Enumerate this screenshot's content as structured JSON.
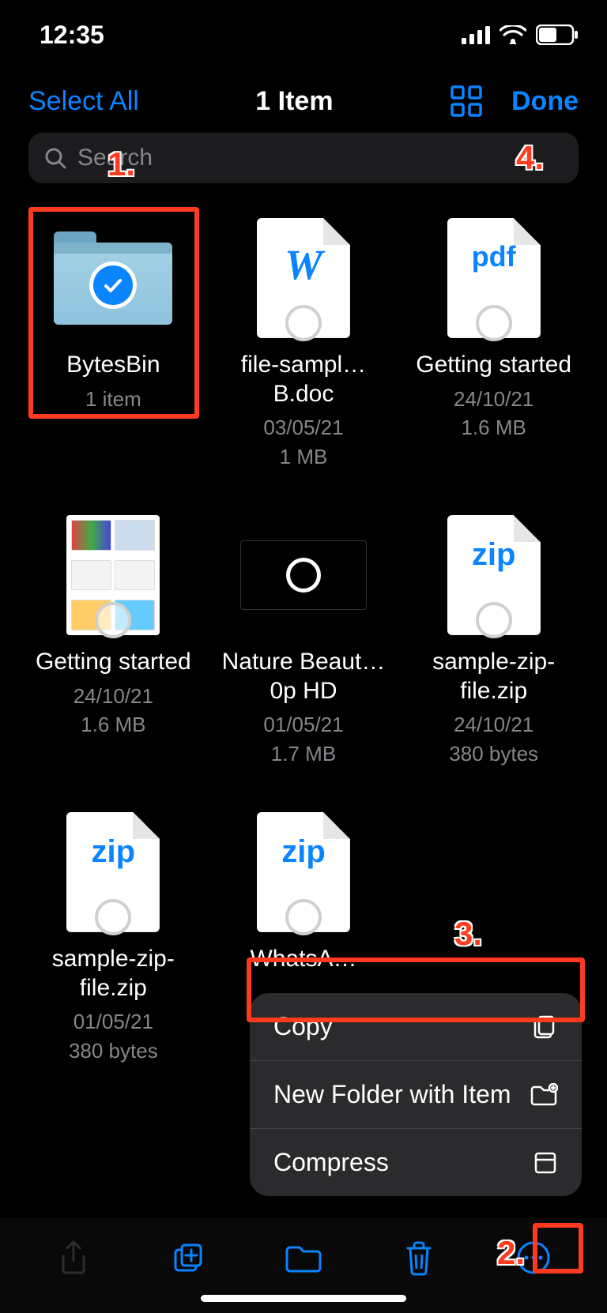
{
  "status": {
    "time": "12:35"
  },
  "nav": {
    "select_all": "Select All",
    "title": "1 Item",
    "done": "Done"
  },
  "search": {
    "placeholder": "Search"
  },
  "files": [
    {
      "name": "BytesBin",
      "meta1": "1 item",
      "meta2": ""
    },
    {
      "name": "file-sampl…B.doc",
      "meta1": "03/05/21",
      "meta2": "1 MB"
    },
    {
      "name": "Getting started",
      "meta1": "24/10/21",
      "meta2": "1.6 MB"
    },
    {
      "name": "Getting started",
      "meta1": "24/10/21",
      "meta2": "1.6 MB"
    },
    {
      "name": "Nature Beaut…0p HD",
      "meta1": "01/05/21",
      "meta2": "1.7 MB"
    },
    {
      "name": "sample-zip-file.zip",
      "meta1": "24/10/21",
      "meta2": "380 bytes"
    },
    {
      "name": "sample-zip-file.zip",
      "meta1": "01/05/21",
      "meta2": "380 bytes"
    },
    {
      "name": "WhatsA…",
      "meta1": "",
      "meta2": ""
    }
  ],
  "menu": {
    "copy": "Copy",
    "new_folder": "New Folder with Item",
    "compress": "Compress"
  },
  "ann": {
    "n1": "1.",
    "n2": "2.",
    "n3": "3.",
    "n4": "4."
  }
}
